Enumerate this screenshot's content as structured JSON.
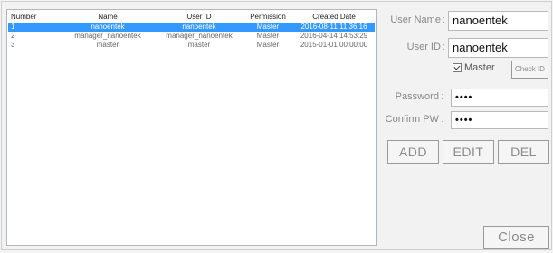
{
  "user_list": {
    "columns": [
      "Number",
      "Name",
      "User ID",
      "Permission",
      "Created Date"
    ],
    "rows": [
      {
        "number": "1",
        "name": "nanoentek",
        "user_id": "nanoentek",
        "permission": "Master",
        "created": "2016-08-11 11:36:16",
        "selected": true
      },
      {
        "number": "2",
        "name": "manager_nanoentek",
        "user_id": "manager_nanoentek",
        "permission": "Master",
        "created": "2016-04-14 14:53:29",
        "selected": false
      },
      {
        "number": "3",
        "name": "master",
        "user_id": "master",
        "permission": "Master",
        "created": "2015-01-01 00:00:00",
        "selected": false
      }
    ]
  },
  "form": {
    "user_name_label": "User Name",
    "user_name_value": "nanoentek",
    "user_id_label": "User ID",
    "user_id_value": "nanoentek",
    "master_label": "Master",
    "master_checked": true,
    "check_id_label": "Check ID",
    "password_label": "Password",
    "password_value": "••••",
    "confirm_label": "Confirm PW",
    "confirm_value": "••••",
    "colon": ":"
  },
  "actions": {
    "add_label": "ADD",
    "edit_label": "EDIT",
    "del_label": "DEL",
    "close_label": "Close"
  },
  "colors": {
    "selection": "#3399ff"
  }
}
